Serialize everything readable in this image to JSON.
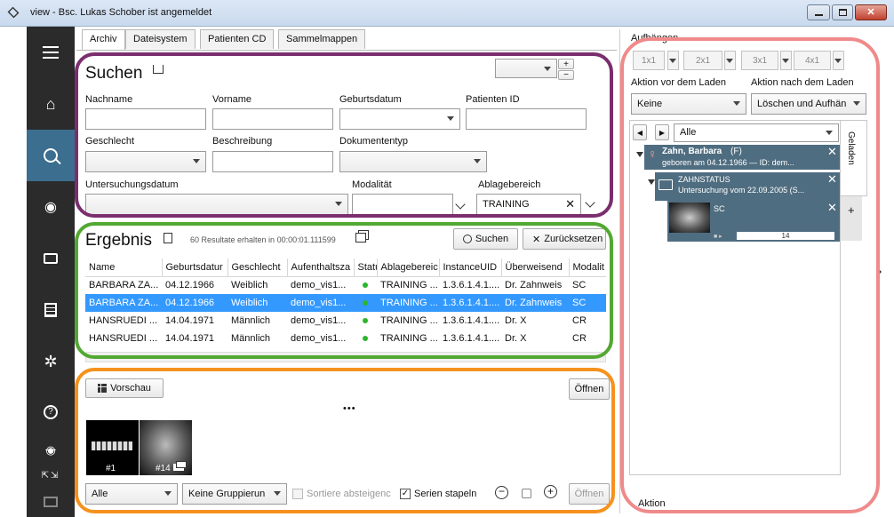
{
  "window": {
    "title": "view - Bsc. Lukas Schober ist angemeldet"
  },
  "sidebar": {
    "icons": [
      "menu-icon",
      "home-icon",
      "search-icon",
      "eye-icon",
      "printer-icon",
      "document-icon",
      "gear-icon",
      "help-icon",
      "eye-off-icon",
      "fullscreen-icon",
      "monitor-icon"
    ]
  },
  "tabs": [
    "Archiv",
    "Dateisystem",
    "Patienten CD",
    "Sammelmappen"
  ],
  "search": {
    "title": "Suchen",
    "nachname_label": "Nachname",
    "vorname_label": "Vorname",
    "geburtsdatum_label": "Geburtsdatum",
    "patientid_label": "Patienten ID",
    "geschlecht_label": "Geschlecht",
    "beschreibung_label": "Beschreibung",
    "dokumenttyp_label": "Dokumententyp",
    "untersuchungsdatum_label": "Untersuchungsdatum",
    "modalitaet_label": "Modalität",
    "ablagebereich_label": "Ablagebereich",
    "ablagebereich_value": "TRAINING"
  },
  "result": {
    "title": "Ergebnis",
    "status": "60 Resultate erhalten in 00:00:01.111599",
    "search_button": "Suchen",
    "reset_button": "Zurücksetzen",
    "columns": [
      "Name",
      "Geburtsdatur",
      "Geschlecht",
      "Aufenthaltsza",
      "Statu",
      "Ablagebereic",
      "InstanceUID",
      "Überweisend",
      "Modalit"
    ],
    "rows": [
      [
        "BARBARA ZA...",
        "04.12.1966",
        "Weiblich",
        "demo_vis1...",
        "",
        "TRAINING ...",
        "1.3.6.1.4.1....",
        "Dr. Zahnweis",
        "SC"
      ],
      [
        "BARBARA ZA...",
        "04.12.1966",
        "Weiblich",
        "demo_vis1...",
        "",
        "TRAINING ...",
        "1.3.6.1.4.1....",
        "Dr. Zahnweis",
        "SC"
      ],
      [
        "HANSRUEDI ...",
        "14.04.1971",
        "Männlich",
        "demo_vis1...",
        "",
        "TRAINING ...",
        "1.3.6.1.4.1....",
        "Dr. X",
        "CR"
      ],
      [
        "HANSRUEDI ...",
        "14.04.1971",
        "Männlich",
        "demo_vis1...",
        "",
        "TRAINING ...",
        "1.3.6.1.4.1....",
        "Dr. X",
        "CR"
      ]
    ],
    "selected_row": 1
  },
  "preview": {
    "button": "Vorschau",
    "open_button": "Öffnen",
    "more": "•••",
    "thumbs": [
      "#1",
      "#14"
    ],
    "filter_value": "Alle",
    "grouping_value": "Keine Gruppierun",
    "sort_label": "Sortiere absteigenc",
    "stack_label": "Serien stapeln",
    "open_button2": "Öffnen"
  },
  "right": {
    "hang_label": "Aufhängen",
    "layouts": [
      "1x1",
      "2x1",
      "3x1",
      "4x1"
    ],
    "before_label": "Aktion vor dem Laden",
    "after_label": "Aktion nach dem Laden",
    "before_value": "Keine",
    "after_value": "Löschen und Aufhän",
    "filter_value": "Alle",
    "side_tab": "Geladen",
    "patient_name": "Zahn, Barbara",
    "patient_sex": "(F)",
    "patient_info": "geboren am 04.12.1966 — ID: dem...",
    "study_name": "ZAHNSTATUS",
    "study_info": "Untersuchung vom 22.09.2005 (S...",
    "series_label": "SC",
    "series_count": "14",
    "actions_label": "Aktion"
  },
  "colors": {
    "purple": "#7a2e6e",
    "green": "#52a832",
    "orange": "#f5921e",
    "pink": "#f08a8a",
    "selection": "#3399ff",
    "sidebar": "#2b2b2b"
  }
}
